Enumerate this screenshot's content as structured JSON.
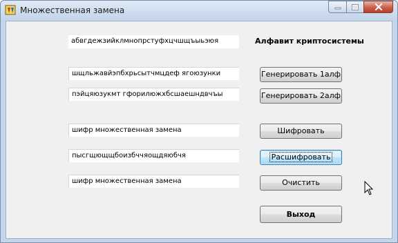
{
  "window": {
    "title": "Множественная замена"
  },
  "alphabet": {
    "value": "абвгдежзийклмнопрстуфхцчшщъыьэюя",
    "label": "Алфавит криптосистемы"
  },
  "alphabet1": {
    "value": "шщльжавйэпбхрьсытчмцдеф ягоюзунки",
    "button": "Генерировать 1алф"
  },
  "alphabet2": {
    "value": "пэйцяюзукмт гфорилюжхбсшаешндвчъы",
    "button": "Генерировать 2алф"
  },
  "plaintext": {
    "value": "шифр множественная замена",
    "button": "Шифровать"
  },
  "ciphertext": {
    "value": "пысгщющщбоизбччяощдяюбчя",
    "button": "Расшифровать"
  },
  "decrypted": {
    "value": "шифр множественная замена",
    "button": "Очистить"
  },
  "exit": {
    "button": "Выход"
  }
}
